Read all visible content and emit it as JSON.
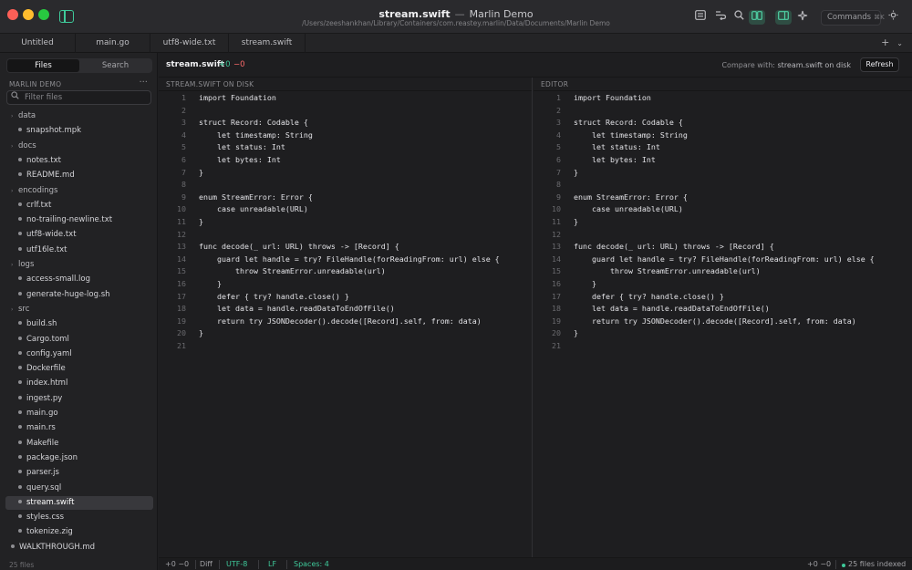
{
  "window": {
    "title": "stream.swift",
    "separator": "—",
    "project": "Marlin Demo",
    "path": "/Users/zeeshankhan/Library/Containers/com.reastey.marlin/Data/Documents/Marlin Demo"
  },
  "toolbar": {
    "commands_label": "Commands",
    "commands_shortcut": "⌘K"
  },
  "tabs": [
    {
      "label": "Untitled"
    },
    {
      "label": "main.go"
    },
    {
      "label": "utf8-wide.txt"
    },
    {
      "label": "stream.swift"
    }
  ],
  "tab_actions": {
    "add": "+",
    "menu": "⌄"
  },
  "sidebar": {
    "segments": {
      "files": "Files",
      "search": "Search"
    },
    "section_title": "MARLIN DEMO",
    "section_more": "···",
    "filter_placeholder": "Filter files",
    "tree": [
      {
        "label": "data",
        "folder": true,
        "depth": 0
      },
      {
        "label": "snapshot.mpk",
        "folder": false,
        "depth": 1
      },
      {
        "label": "docs",
        "folder": true,
        "depth": 0
      },
      {
        "label": "notes.txt",
        "folder": false,
        "depth": 1
      },
      {
        "label": "README.md",
        "folder": false,
        "depth": 1
      },
      {
        "label": "encodings",
        "folder": true,
        "depth": 0
      },
      {
        "label": "crlf.txt",
        "folder": false,
        "depth": 1
      },
      {
        "label": "no-trailing-newline.txt",
        "folder": false,
        "depth": 1
      },
      {
        "label": "utf8-wide.txt",
        "folder": false,
        "depth": 1
      },
      {
        "label": "utf16le.txt",
        "folder": false,
        "depth": 1
      },
      {
        "label": "logs",
        "folder": true,
        "depth": 0
      },
      {
        "label": "access-small.log",
        "folder": false,
        "depth": 1
      },
      {
        "label": "generate-huge-log.sh",
        "folder": false,
        "depth": 1
      },
      {
        "label": "src",
        "folder": true,
        "depth": 0
      },
      {
        "label": "build.sh",
        "folder": false,
        "depth": 1
      },
      {
        "label": "Cargo.toml",
        "folder": false,
        "depth": 1
      },
      {
        "label": "config.yaml",
        "folder": false,
        "depth": 1
      },
      {
        "label": "Dockerfile",
        "folder": false,
        "depth": 1
      },
      {
        "label": "index.html",
        "folder": false,
        "depth": 1
      },
      {
        "label": "ingest.py",
        "folder": false,
        "depth": 1
      },
      {
        "label": "main.go",
        "folder": false,
        "depth": 1
      },
      {
        "label": "main.rs",
        "folder": false,
        "depth": 1
      },
      {
        "label": "Makefile",
        "folder": false,
        "depth": 1
      },
      {
        "label": "package.json",
        "folder": false,
        "depth": 1
      },
      {
        "label": "parser.js",
        "folder": false,
        "depth": 1
      },
      {
        "label": "query.sql",
        "folder": false,
        "depth": 1
      },
      {
        "label": "stream.swift",
        "folder": false,
        "depth": 1,
        "selected": true
      },
      {
        "label": "styles.css",
        "folder": false,
        "depth": 1
      },
      {
        "label": "tokenize.zig",
        "folder": false,
        "depth": 1
      },
      {
        "label": "WALKTHROUGH.md",
        "folder": false,
        "depth": 0
      }
    ],
    "footer": "25 files"
  },
  "diff_header": {
    "file": "stream.swift",
    "added": "+0",
    "removed": "−0",
    "compare_prefix": "Compare with:",
    "compare_target": "stream.swift on disk",
    "refresh": "Refresh"
  },
  "panes": {
    "left_title": "STREAM.SWIFT ON DISK",
    "right_title": "EDITOR"
  },
  "code_lines": [
    "import Foundation",
    "",
    "struct Record: Codable {",
    "    let timestamp: String",
    "    let status: Int",
    "    let bytes: Int",
    "}",
    "",
    "enum StreamError: Error {",
    "    case unreadable(URL)",
    "}",
    "",
    "func decode(_ url: URL) throws -> [Record] {",
    "    guard let handle = try? FileHandle(forReadingFrom: url) else {",
    "        throw StreamError.unreadable(url)",
    "    }",
    "    defer { try? handle.close() }",
    "    let data = handle.readDataToEndOfFile()",
    "    return try JSONDecoder().decode([Record].self, from: data)",
    "}",
    ""
  ],
  "status_bar": {
    "diffstat": "+0 −0",
    "mode": "Diff",
    "encoding": "UTF-8",
    "line_ending": "LF",
    "indent": "Spaces: 4",
    "right_diffstat": "+0 −0",
    "indexed": "25 files indexed"
  },
  "colors": {
    "accent": "#3ec99a",
    "removed": "#ff6b6b",
    "background": "#1e1e20"
  }
}
